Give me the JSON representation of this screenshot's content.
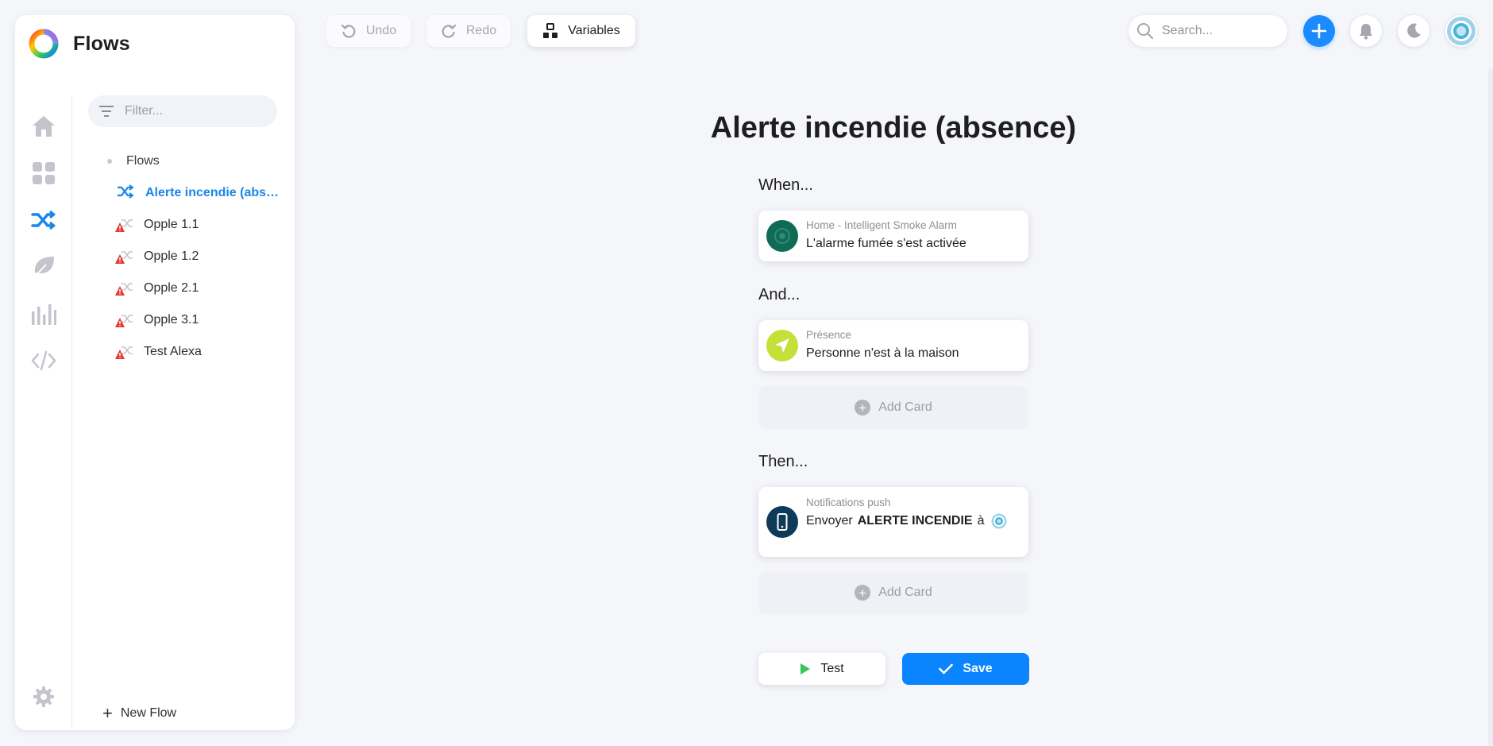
{
  "sidebar": {
    "title": "Flows",
    "filter_placeholder": "Filter...",
    "rail": [
      "home-icon",
      "dashboard-grid-icon",
      "flows-shuffle-icon",
      "energy-leaf-icon",
      "insights-bars-icon",
      "code-icon",
      "settings-gear-icon"
    ],
    "tree_root": "Flows",
    "flows": [
      {
        "label": "Alerte incendie (abs…",
        "state": "active"
      },
      {
        "label": "Opple 1.1",
        "state": "broken"
      },
      {
        "label": "Opple 1.2",
        "state": "broken"
      },
      {
        "label": "Opple 2.1",
        "state": "broken"
      },
      {
        "label": "Opple 3.1",
        "state": "broken"
      },
      {
        "label": "Test Alexa",
        "state": "broken"
      }
    ],
    "new_flow_label": "New Flow"
  },
  "toolbar": {
    "undo_label": "Undo",
    "redo_label": "Redo",
    "variables_label": "Variables",
    "search_placeholder": "Search..."
  },
  "flow": {
    "title": "Alerte incendie (absence)",
    "when_label": "When...",
    "and_label": "And...",
    "then_label": "Then...",
    "when_card": {
      "subtitle": "Home - Intelligent Smoke Alarm",
      "text": "L'alarme fumée s'est activée"
    },
    "and_card": {
      "subtitle": "Présence",
      "text": "Personne n'est à la maison"
    },
    "then_card": {
      "subtitle": "Notifications push",
      "text_prefix": "Envoyer",
      "message": "ALERTE INCENDIE",
      "text_suffix": "à"
    },
    "add_card_label": "Add Card",
    "test_label": "Test",
    "save_label": "Save"
  },
  "colors": {
    "accent": "#0a84ff",
    "active_flow": "#1a86e8",
    "smoke_alarm_icon": "#0f6b55",
    "presence_icon": "#c6e03a",
    "notification_icon": "#103a5a",
    "warning": "#e53935"
  }
}
